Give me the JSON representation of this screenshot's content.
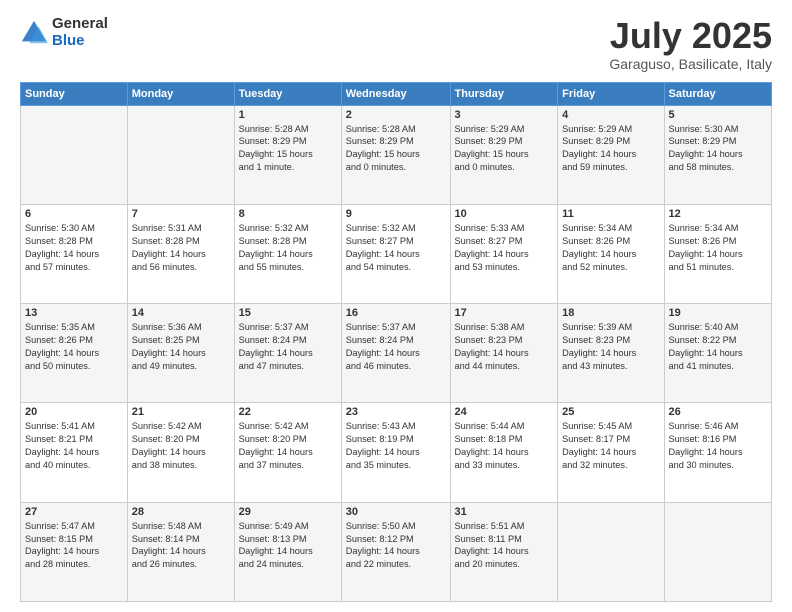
{
  "header": {
    "logo_general": "General",
    "logo_blue": "Blue",
    "title": "July 2025",
    "subtitle": "Garaguso, Basilicate, Italy"
  },
  "days_of_week": [
    "Sunday",
    "Monday",
    "Tuesday",
    "Wednesday",
    "Thursday",
    "Friday",
    "Saturday"
  ],
  "weeks": [
    [
      {
        "day": "",
        "info": ""
      },
      {
        "day": "",
        "info": ""
      },
      {
        "day": "1",
        "info": "Sunrise: 5:28 AM\nSunset: 8:29 PM\nDaylight: 15 hours\nand 1 minute."
      },
      {
        "day": "2",
        "info": "Sunrise: 5:28 AM\nSunset: 8:29 PM\nDaylight: 15 hours\nand 0 minutes."
      },
      {
        "day": "3",
        "info": "Sunrise: 5:29 AM\nSunset: 8:29 PM\nDaylight: 15 hours\nand 0 minutes."
      },
      {
        "day": "4",
        "info": "Sunrise: 5:29 AM\nSunset: 8:29 PM\nDaylight: 14 hours\nand 59 minutes."
      },
      {
        "day": "5",
        "info": "Sunrise: 5:30 AM\nSunset: 8:29 PM\nDaylight: 14 hours\nand 58 minutes."
      }
    ],
    [
      {
        "day": "6",
        "info": "Sunrise: 5:30 AM\nSunset: 8:28 PM\nDaylight: 14 hours\nand 57 minutes."
      },
      {
        "day": "7",
        "info": "Sunrise: 5:31 AM\nSunset: 8:28 PM\nDaylight: 14 hours\nand 56 minutes."
      },
      {
        "day": "8",
        "info": "Sunrise: 5:32 AM\nSunset: 8:28 PM\nDaylight: 14 hours\nand 55 minutes."
      },
      {
        "day": "9",
        "info": "Sunrise: 5:32 AM\nSunset: 8:27 PM\nDaylight: 14 hours\nand 54 minutes."
      },
      {
        "day": "10",
        "info": "Sunrise: 5:33 AM\nSunset: 8:27 PM\nDaylight: 14 hours\nand 53 minutes."
      },
      {
        "day": "11",
        "info": "Sunrise: 5:34 AM\nSunset: 8:26 PM\nDaylight: 14 hours\nand 52 minutes."
      },
      {
        "day": "12",
        "info": "Sunrise: 5:34 AM\nSunset: 8:26 PM\nDaylight: 14 hours\nand 51 minutes."
      }
    ],
    [
      {
        "day": "13",
        "info": "Sunrise: 5:35 AM\nSunset: 8:26 PM\nDaylight: 14 hours\nand 50 minutes."
      },
      {
        "day": "14",
        "info": "Sunrise: 5:36 AM\nSunset: 8:25 PM\nDaylight: 14 hours\nand 49 minutes."
      },
      {
        "day": "15",
        "info": "Sunrise: 5:37 AM\nSunset: 8:24 PM\nDaylight: 14 hours\nand 47 minutes."
      },
      {
        "day": "16",
        "info": "Sunrise: 5:37 AM\nSunset: 8:24 PM\nDaylight: 14 hours\nand 46 minutes."
      },
      {
        "day": "17",
        "info": "Sunrise: 5:38 AM\nSunset: 8:23 PM\nDaylight: 14 hours\nand 44 minutes."
      },
      {
        "day": "18",
        "info": "Sunrise: 5:39 AM\nSunset: 8:23 PM\nDaylight: 14 hours\nand 43 minutes."
      },
      {
        "day": "19",
        "info": "Sunrise: 5:40 AM\nSunset: 8:22 PM\nDaylight: 14 hours\nand 41 minutes."
      }
    ],
    [
      {
        "day": "20",
        "info": "Sunrise: 5:41 AM\nSunset: 8:21 PM\nDaylight: 14 hours\nand 40 minutes."
      },
      {
        "day": "21",
        "info": "Sunrise: 5:42 AM\nSunset: 8:20 PM\nDaylight: 14 hours\nand 38 minutes."
      },
      {
        "day": "22",
        "info": "Sunrise: 5:42 AM\nSunset: 8:20 PM\nDaylight: 14 hours\nand 37 minutes."
      },
      {
        "day": "23",
        "info": "Sunrise: 5:43 AM\nSunset: 8:19 PM\nDaylight: 14 hours\nand 35 minutes."
      },
      {
        "day": "24",
        "info": "Sunrise: 5:44 AM\nSunset: 8:18 PM\nDaylight: 14 hours\nand 33 minutes."
      },
      {
        "day": "25",
        "info": "Sunrise: 5:45 AM\nSunset: 8:17 PM\nDaylight: 14 hours\nand 32 minutes."
      },
      {
        "day": "26",
        "info": "Sunrise: 5:46 AM\nSunset: 8:16 PM\nDaylight: 14 hours\nand 30 minutes."
      }
    ],
    [
      {
        "day": "27",
        "info": "Sunrise: 5:47 AM\nSunset: 8:15 PM\nDaylight: 14 hours\nand 28 minutes."
      },
      {
        "day": "28",
        "info": "Sunrise: 5:48 AM\nSunset: 8:14 PM\nDaylight: 14 hours\nand 26 minutes."
      },
      {
        "day": "29",
        "info": "Sunrise: 5:49 AM\nSunset: 8:13 PM\nDaylight: 14 hours\nand 24 minutes."
      },
      {
        "day": "30",
        "info": "Sunrise: 5:50 AM\nSunset: 8:12 PM\nDaylight: 14 hours\nand 22 minutes."
      },
      {
        "day": "31",
        "info": "Sunrise: 5:51 AM\nSunset: 8:11 PM\nDaylight: 14 hours\nand 20 minutes."
      },
      {
        "day": "",
        "info": ""
      },
      {
        "day": "",
        "info": ""
      }
    ]
  ]
}
